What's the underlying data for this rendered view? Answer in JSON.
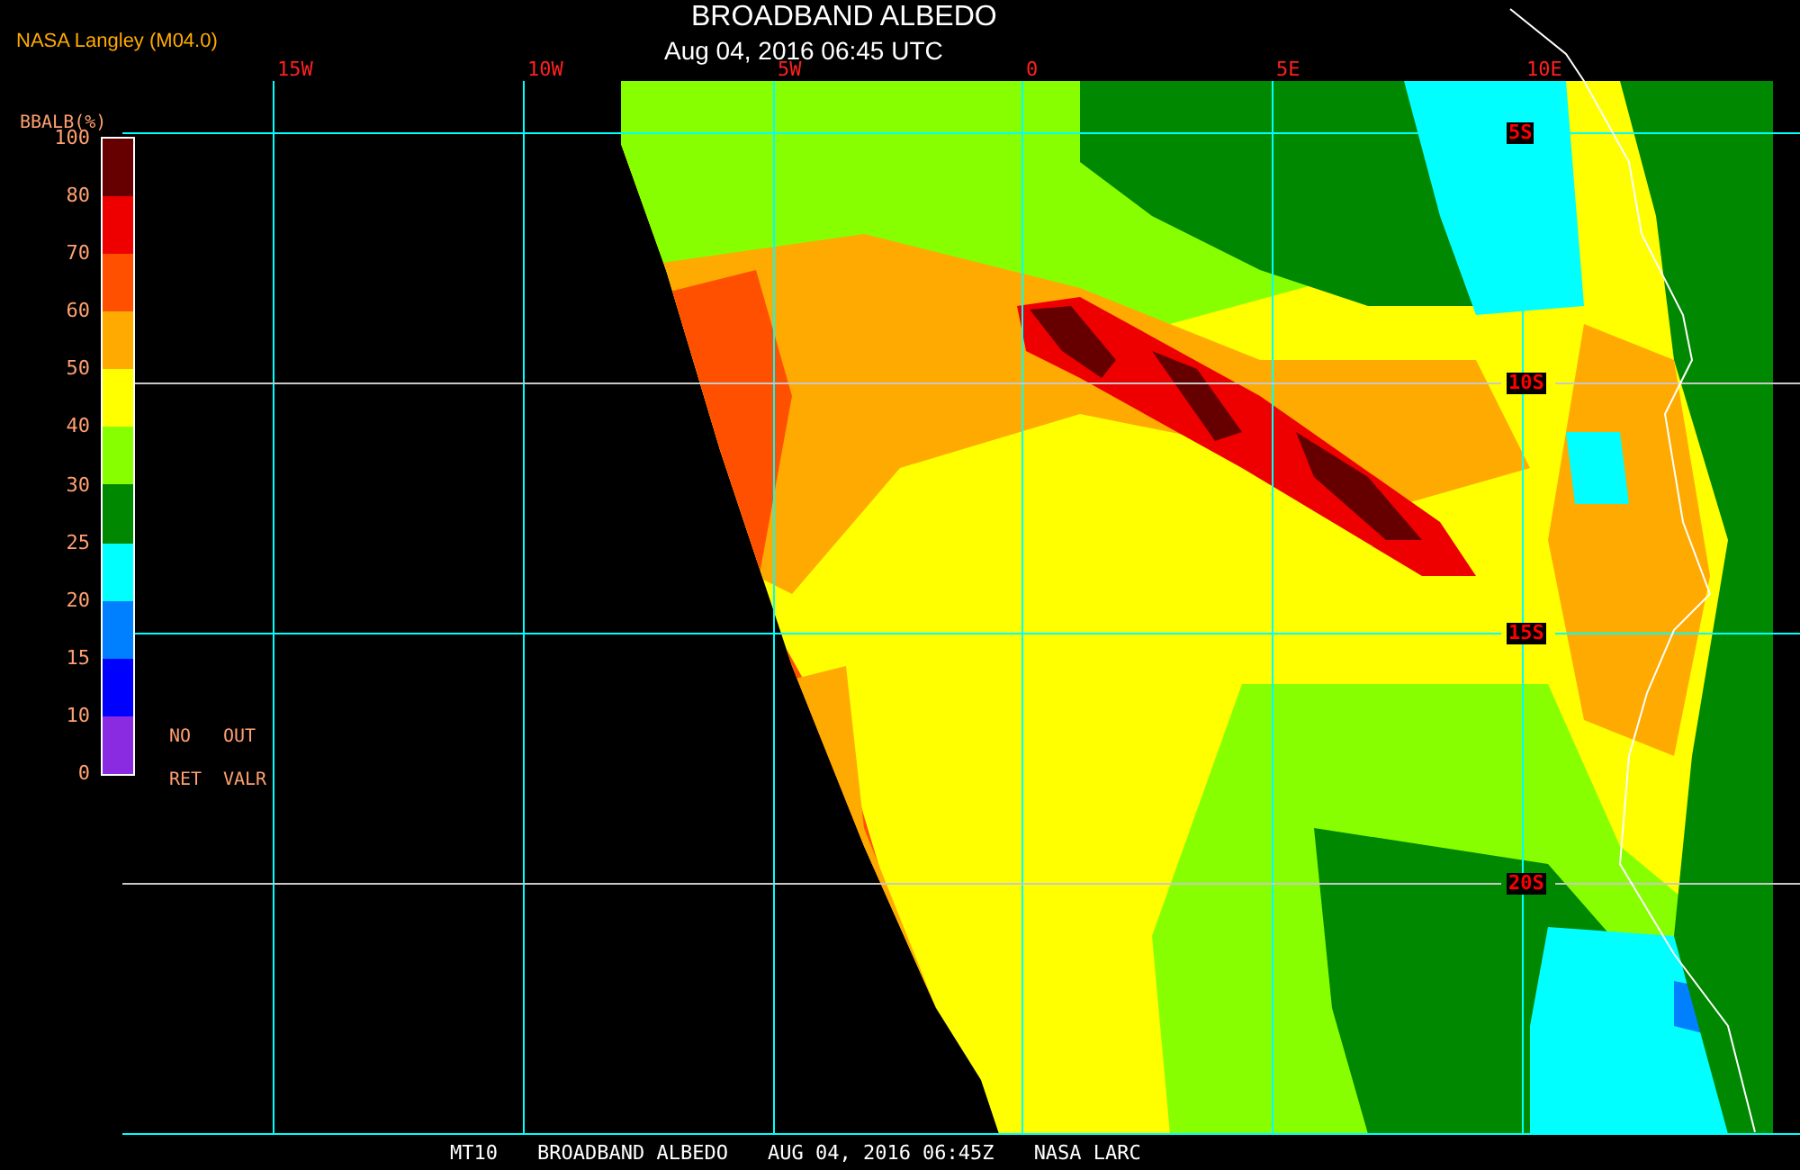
{
  "header": {
    "source": "NASA Langley (M04.0)",
    "title": "BROADBAND ALBEDO",
    "datetime": "Aug 04, 2016 06:45 UTC"
  },
  "legend": {
    "title": "BBALB(%)",
    "ticks": [
      "100",
      "80",
      "70",
      "60",
      "50",
      "40",
      "30",
      "25",
      "20",
      "15",
      "10",
      "0"
    ],
    "bands": [
      {
        "color": "#660000"
      },
      {
        "color": "#ee0000"
      },
      {
        "color": "#ff5000"
      },
      {
        "color": "#ffaa00"
      },
      {
        "color": "#ffff00"
      },
      {
        "color": "#88ff00"
      },
      {
        "color": "#008800"
      },
      {
        "color": "#00ffff"
      },
      {
        "color": "#0080ff"
      },
      {
        "color": "#0000ff"
      },
      {
        "color": "#8a2be2"
      }
    ],
    "notes": [
      "NO",
      "OUT",
      "RET",
      "VALR"
    ]
  },
  "map": {
    "longitude_labels": [
      "15W",
      "10W",
      "5W",
      "0",
      "5E",
      "10E"
    ],
    "latitude_labels": [
      "5S",
      "10S",
      "15S",
      "20S"
    ]
  },
  "footer": {
    "parts": [
      "MT10",
      "BROADBAND ALBEDO",
      "AUG 04, 2016 06:45Z",
      "NASA LARC"
    ]
  }
}
